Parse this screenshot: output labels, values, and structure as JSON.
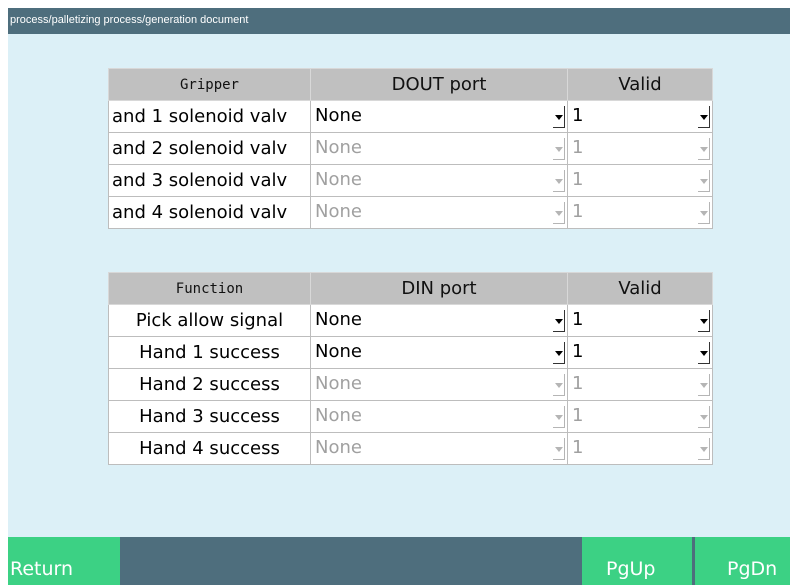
{
  "title_path": "process/palletizing process/generation document",
  "gripper_table": {
    "headers": [
      "Gripper",
      "DOUT port",
      "Valid"
    ],
    "rows": [
      {
        "name": "and 1 solenoid valv",
        "port": "None",
        "valid": "1",
        "enabled": true
      },
      {
        "name": "and 2 solenoid valv",
        "port": "None",
        "valid": "1",
        "enabled": false
      },
      {
        "name": "and 3 solenoid valv",
        "port": "None",
        "valid": "1",
        "enabled": false
      },
      {
        "name": "and 4 solenoid valv",
        "port": "None",
        "valid": "1",
        "enabled": false
      }
    ]
  },
  "function_table": {
    "headers": [
      "Function",
      "DIN port",
      "Valid"
    ],
    "rows": [
      {
        "name": "Pick allow signal",
        "port": "None",
        "valid": "1",
        "enabled": true
      },
      {
        "name": "Hand 1 success",
        "port": "None",
        "valid": "1",
        "enabled": true
      },
      {
        "name": "Hand 2 success",
        "port": "None",
        "valid": "1",
        "enabled": false
      },
      {
        "name": "Hand 3 success",
        "port": "None",
        "valid": "1",
        "enabled": false
      },
      {
        "name": "Hand 4 success",
        "port": "None",
        "valid": "1",
        "enabled": false
      }
    ]
  },
  "buttons": {
    "return": "Return",
    "pgup": "PgUp",
    "pgdn": "PgDn"
  },
  "colors": {
    "bar": "#4e6e7d",
    "background": "#dcf0f7",
    "button": "#3cd184",
    "header": "#c0c0c0",
    "disabled_text": "#a0a0a0"
  },
  "icons": {
    "dropdown": "chevron-down-icon"
  }
}
